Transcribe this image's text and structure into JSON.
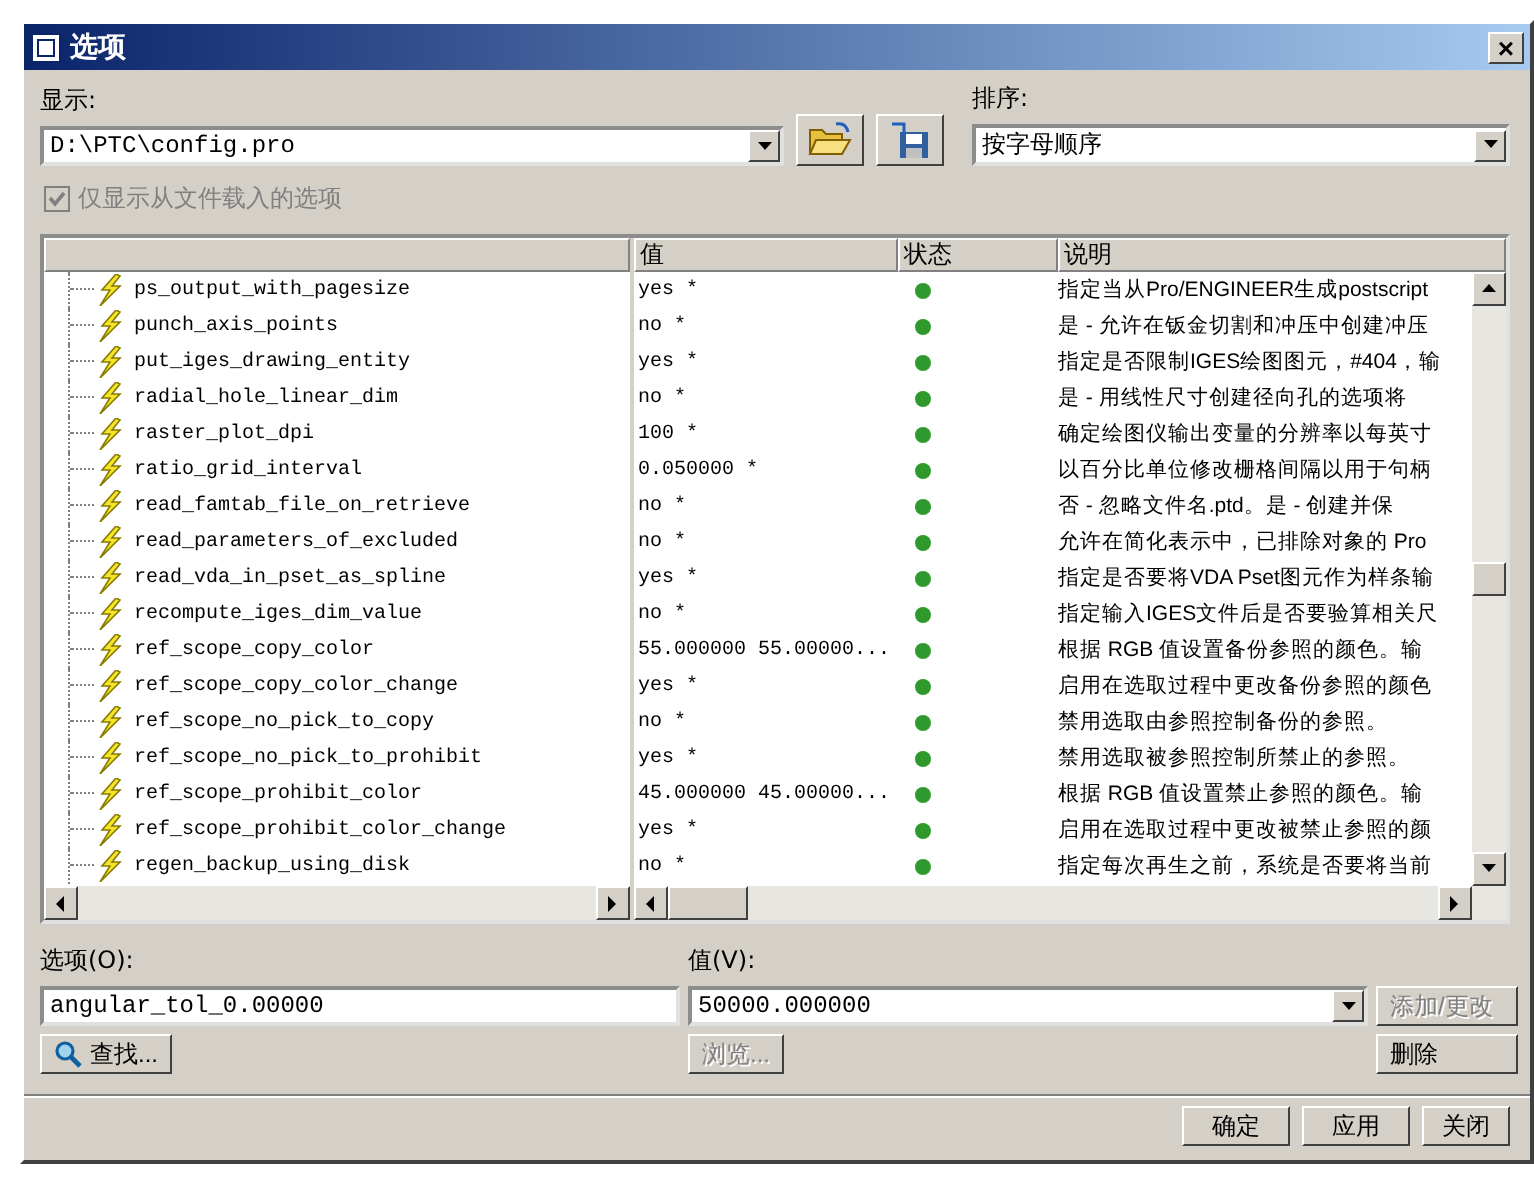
{
  "window": {
    "title": "选项",
    "close": "×"
  },
  "display": {
    "label": "显示:",
    "value": "D:\\PTC\\config.pro"
  },
  "sort": {
    "label": "排序:",
    "value": "按字母顺序"
  },
  "filter_checkbox": {
    "label": "仅显示从文件载入的选项",
    "checked": true,
    "disabled": true
  },
  "table": {
    "columns": [
      "值",
      "状态",
      "说明"
    ],
    "rows": [
      {
        "name": "ps_output_with_pagesize",
        "value": "yes *",
        "description": "指定当从Pro/ENGINEER生成postscript"
      },
      {
        "name": "punch_axis_points",
        "value": "no *",
        "description": "是 - 允许在钣金切割和冲压中创建冲压"
      },
      {
        "name": "put_iges_drawing_entity",
        "value": "yes *",
        "description": "指定是否限制IGES绘图图元，#404，输"
      },
      {
        "name": "radial_hole_linear_dim",
        "value": "no *",
        "description": "是 - 用线性尺寸创建径向孔的选项将"
      },
      {
        "name": "raster_plot_dpi",
        "value": "100 *",
        "description": "确定绘图仪输出变量的分辨率以每英寸"
      },
      {
        "name": "ratio_grid_interval",
        "value": "0.050000 *",
        "description": "以百分比单位修改栅格间隔以用于句柄"
      },
      {
        "name": "read_famtab_file_on_retrieve",
        "value": "no *",
        "description": "否 - 忽略文件名.ptd。是 - 创建并保"
      },
      {
        "name": "read_parameters_of_excluded",
        "value": "no *",
        "description": "允许在简化表示中，已排除对象的 Pro"
      },
      {
        "name": "read_vda_in_pset_as_spline",
        "value": "yes *",
        "description": "指定是否要将VDA Pset图元作为样条输"
      },
      {
        "name": "recompute_iges_dim_value",
        "value": "no *",
        "description": "指定输入IGES文件后是否要验算相关尺"
      },
      {
        "name": "ref_scope_copy_color",
        "value": "55.000000 55.00000...",
        "description": "根据 RGB 值设置备份参照的颜色。输"
      },
      {
        "name": "ref_scope_copy_color_change",
        "value": "yes *",
        "description": "启用在选取过程中更改备份参照的颜色"
      },
      {
        "name": "ref_scope_no_pick_to_copy",
        "value": "no *",
        "description": "禁用选取由参照控制备份的参照。"
      },
      {
        "name": "ref_scope_no_pick_to_prohibit",
        "value": "yes *",
        "description": "禁用选取被参照控制所禁止的参照。"
      },
      {
        "name": "ref_scope_prohibit_color",
        "value": "45.000000 45.00000...",
        "description": "根据 RGB 值设置禁止参照的颜色。输"
      },
      {
        "name": "ref_scope_prohibit_color_change",
        "value": "yes *",
        "description": "启用在选取过程中更改被禁止参照的颜"
      },
      {
        "name": "regen_backup_using_disk",
        "value": "no *",
        "description": "指定每次再生之前，系统是否要将当前"
      }
    ]
  },
  "option_field": {
    "label": "选项(O):",
    "value": "angular_tol_0.00000"
  },
  "value_field": {
    "label": "值(V):",
    "value": "50000.000000"
  },
  "buttons": [
    {
      "label": "添加/更改",
      "disabled": true,
      "kind": "add"
    },
    {
      "label": "查找...",
      "disabled": false,
      "kind": "find"
    },
    {
      "label": "浏览...",
      "disabled": true,
      "kind": "browse"
    },
    {
      "label": "删除",
      "disabled": false,
      "kind": "delete"
    }
  ],
  "footer_buttons": [
    "确定",
    "应用",
    "关闭"
  ]
}
